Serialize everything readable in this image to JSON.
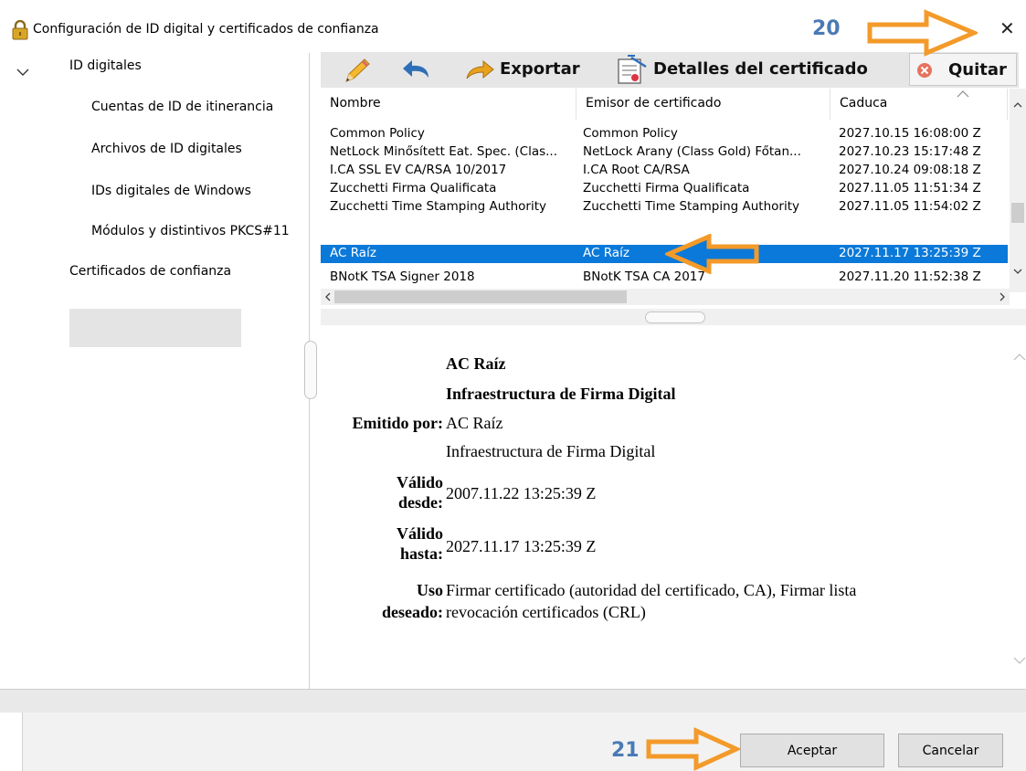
{
  "window": {
    "title": "Configuración de ID digital y certificados de confianza",
    "close_glyph": "✕",
    "lock_icon": "lock-icon"
  },
  "sidebar": {
    "expand_glyph": "⌄",
    "items": [
      {
        "label": "ID digitales"
      },
      {
        "label": "Cuentas de ID de itinerancia"
      },
      {
        "label": "Archivos de ID digitales"
      },
      {
        "label": "IDs digitales de Windows"
      },
      {
        "label": "Módulos y distintivos PKCS#11"
      },
      {
        "label": "Certificados de confianza",
        "selected": true
      }
    ]
  },
  "toolbar": {
    "export_label": "Exportar",
    "details_label": "Detalles del certificado",
    "remove_label": "Quitar"
  },
  "table": {
    "columns": [
      "Nombre",
      "Emisor de certificado",
      "Caduca"
    ],
    "rows": [
      {
        "name": "Common Policy",
        "issuer": "Common Policy",
        "expires": "2027.10.15 16:08:00 Z"
      },
      {
        "name": "NetLock Minősített Eat. Spec. (Clas...",
        "issuer": "NetLock Arany (Class Gold) Főtan...",
        "expires": "2027.10.23 15:17:48 Z"
      },
      {
        "name": "I.CA SSL EV CA/RSA 10/2017",
        "issuer": "I.CA Root CA/RSA",
        "expires": "2027.10.24 09:08:18 Z"
      },
      {
        "name": "Zucchetti Firma Qualificata",
        "issuer": "Zucchetti Firma Qualificata",
        "expires": "2027.11.05 11:51:34 Z"
      },
      {
        "name": "Zucchetti Time Stamping Authority",
        "issuer": "Zucchetti Time Stamping Authority",
        "expires": "2027.11.05 11:54:02 Z"
      },
      {
        "name": "AC Raíz",
        "issuer": "AC Raíz",
        "expires": "2027.11.17 13:25:39 Z",
        "selected": true
      },
      {
        "name": "BNotK TSA Signer 2018",
        "issuer": "BNotK TSA CA 2017",
        "expires": "2027.11.20 11:52:38 Z"
      }
    ]
  },
  "details": {
    "subject_name": "AC Raíz",
    "subject_org": "Infraestructura de Firma Digital",
    "issued_by_label": "Emitido por:",
    "issuer_name": "AC Raíz",
    "issuer_org": "Infraestructura de Firma Digital",
    "valid_from_label_1": "Válido",
    "valid_from_label_2": "desde:",
    "valid_from": "2007.11.22 13:25:39 Z",
    "valid_to_label_1": "Válido",
    "valid_to_label_2": "hasta:",
    "valid_to": "2027.11.17 13:25:39 Z",
    "usage_label_1": "Uso",
    "usage_label_2": "deseado:",
    "usage_line_1": "Firmar certificado (autoridad del certificado, CA), Firmar lista",
    "usage_line_2": "revocación certificados (CRL)"
  },
  "footer": {
    "ok_label": "Aceptar",
    "cancel_label": "Cancelar"
  },
  "annotations": {
    "step_20": "20",
    "step_21": "21",
    "arrow_color": "#f39a2a",
    "number_color": "#4a7ab5"
  },
  "colors": {
    "selection": "#0a79d9",
    "toolbar_bg": "#e6e6e6"
  }
}
